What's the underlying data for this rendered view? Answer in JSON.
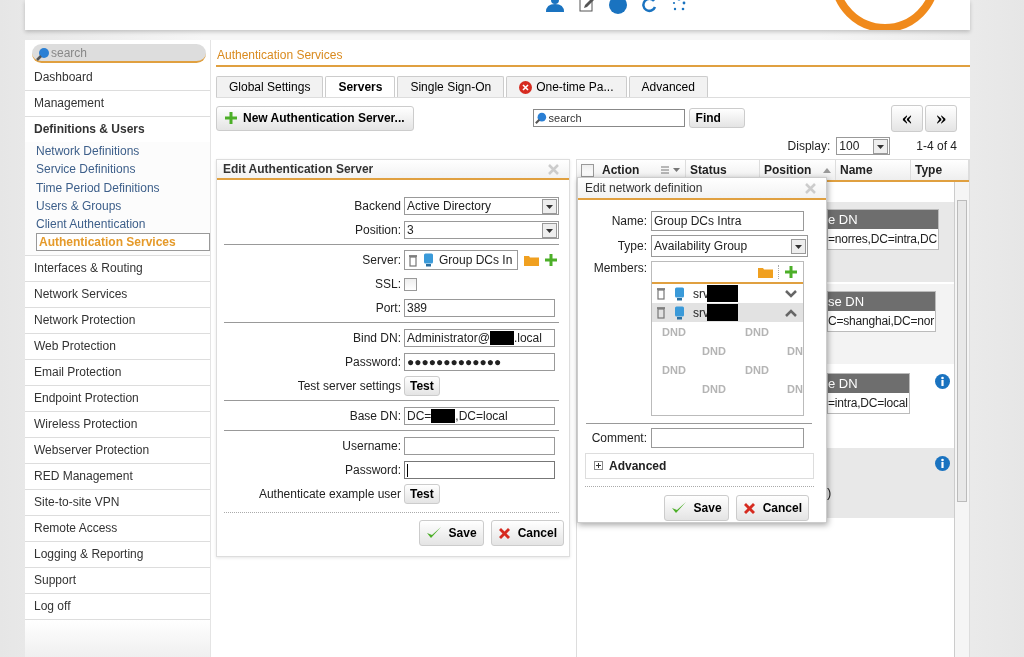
{
  "sidebar": {
    "search": {
      "placeholder": "search"
    },
    "items": [
      {
        "label": "Dashboard",
        "expanded": false
      },
      {
        "label": "Management",
        "expanded": false
      },
      {
        "label": "Definitions & Users",
        "expanded": true,
        "children": [
          {
            "label": "Network Definitions",
            "selected": false
          },
          {
            "label": "Service Definitions",
            "selected": false
          },
          {
            "label": "Time Period Definitions",
            "selected": false
          },
          {
            "label": "Users & Groups",
            "selected": false
          },
          {
            "label": "Client Authentication",
            "selected": false
          },
          {
            "label": "Authentication Services",
            "selected": true
          }
        ]
      },
      {
        "label": "Interfaces & Routing",
        "expanded": false
      },
      {
        "label": "Network Services",
        "expanded": false
      },
      {
        "label": "Network Protection",
        "expanded": false
      },
      {
        "label": "Web Protection",
        "expanded": false
      },
      {
        "label": "Email Protection",
        "expanded": false
      },
      {
        "label": "Endpoint Protection",
        "expanded": false
      },
      {
        "label": "Wireless Protection",
        "expanded": false
      },
      {
        "label": "Webserver Protection",
        "expanded": false
      },
      {
        "label": "RED Management",
        "expanded": false
      },
      {
        "label": "Site-to-site VPN",
        "expanded": false
      },
      {
        "label": "Remote Access",
        "expanded": false
      },
      {
        "label": "Logging & Reporting",
        "expanded": false
      },
      {
        "label": "Support",
        "expanded": false
      },
      {
        "label": "Log off",
        "expanded": false
      }
    ]
  },
  "breadcrumb": "Authentication Services",
  "tabs": [
    {
      "label": "Global Settings",
      "selected": false,
      "error": false
    },
    {
      "label": "Servers",
      "selected": true,
      "error": false
    },
    {
      "label": "Single Sign-On",
      "selected": false,
      "error": false
    },
    {
      "label": "One-time Pa...",
      "selected": false,
      "error": true
    },
    {
      "label": "Advanced",
      "selected": false,
      "error": false
    }
  ],
  "toolbar": {
    "new_button": "New Authentication Server...",
    "search": {
      "placeholder": "search"
    },
    "find_button": "Find",
    "prev_button": "«",
    "next_button": "»"
  },
  "display": {
    "label": "Display:",
    "value": "100",
    "range": "1-4 of 4"
  },
  "edit_panel": {
    "title": "Edit Authentication Server",
    "groups": [
      [
        {
          "kind": "select",
          "label": "Backend",
          "value": "Active Directory"
        },
        {
          "kind": "select",
          "label": "Position:",
          "value": "3"
        }
      ],
      [
        {
          "kind": "server",
          "label": "Server:",
          "value": "Group DCs In"
        },
        {
          "kind": "checkbox",
          "label": "SSL:",
          "checked": false
        },
        {
          "kind": "text",
          "label": "Port:",
          "value": "389"
        }
      ],
      [
        {
          "kind": "text",
          "label": "Bind DN:",
          "value": "Administrator@",
          "redacted": true,
          "value_after": ".local"
        },
        {
          "kind": "text",
          "label": "Password:",
          "value": "●●●●●●●●●●●●●"
        },
        {
          "kind": "button",
          "label": "Test server settings",
          "button": "Test"
        }
      ],
      [
        {
          "kind": "text",
          "label": "Base DN:",
          "value": "DC=",
          "redacted": true,
          "value_after": ",DC=local"
        }
      ],
      [
        {
          "kind": "text",
          "label": "Username:"
        },
        {
          "kind": "text",
          "label": "Password:",
          "focused": true
        },
        {
          "kind": "button",
          "label": "Authenticate example user",
          "button": "Test"
        }
      ]
    ],
    "buttons": [
      "Save",
      "Cancel"
    ]
  },
  "table": {
    "columns": [
      {
        "label": "Action",
        "checked": false,
        "menu": true,
        "sorted": false
      },
      {
        "label": "Status",
        "menu": false,
        "sorted": false
      },
      {
        "label": "Position",
        "menu": false,
        "sorted": true
      },
      {
        "label": "Name",
        "menu": false,
        "sorted": false
      },
      {
        "label": "Type",
        "menu": false,
        "sorted": false
      }
    ],
    "entries": [
      {
        "header": "e DN",
        "value": "=norres,DC=intra,DC",
        "info": false
      },
      {
        "header": "se DN",
        "value": "C=shanghai,DC=nor",
        "info": false
      },
      {
        "header": "e DN",
        "value": "=intra,DC=local",
        "info": true
      },
      {
        "text": ")",
        "info": true
      }
    ]
  },
  "network_dialog": {
    "title": "Edit network definition",
    "name_label": "Name:",
    "name": "Group DCs Intra",
    "type_label": "Type:",
    "type": "Availability Group",
    "members_label": "Members:",
    "members": [
      {
        "name": "srv",
        "redacted": true,
        "selected": false,
        "kind": "first"
      },
      {
        "name": "srv",
        "redacted": true,
        "selected": true,
        "kind": "last"
      }
    ],
    "drop_marks": [
      "DND",
      "DND",
      "DND",
      "DN",
      "DND",
      "DND",
      "DND",
      "DN"
    ],
    "comment_label": "Comment:",
    "advanced": {
      "label": "Advanced",
      "expanded": false
    },
    "buttons": [
      "Save",
      "Cancel"
    ]
  }
}
